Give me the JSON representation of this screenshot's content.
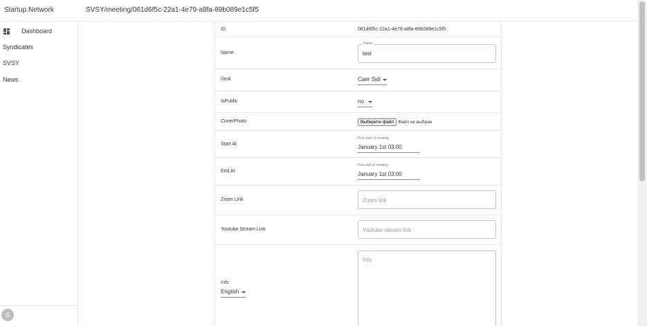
{
  "app": {
    "brand": "Startup.Network"
  },
  "breadcrumb": "SVSY/meeting/061d6f5c-22a1-4e79-a8fa-89b089e1c5f5",
  "sidebar": {
    "items": [
      {
        "label": "Dashboard",
        "icon": "dashboard-icon"
      },
      {
        "label": "Syndicates"
      },
      {
        "label": "SVSY"
      },
      {
        "label": "News"
      }
    ],
    "avatar_initial": "S"
  },
  "form": {
    "id": {
      "label": "ID",
      "value": "061d6f5c-22a1-4e79-a8fa-89b089e1c5f5"
    },
    "name": {
      "label": "Name",
      "legend": "Name",
      "value": "test"
    },
    "deal": {
      "label": "Deal",
      "value": "Caer Sidi"
    },
    "is_public": {
      "label": "IsPublic",
      "value": "no"
    },
    "cover_photo": {
      "label": "CoverPhoto",
      "button": "Выберите файл",
      "status": "Файл не выбран"
    },
    "start_at": {
      "label": "Start At",
      "hint": "Pick start of meeting",
      "value": "January 1st 03:00"
    },
    "end_at": {
      "label": "End At",
      "hint": "Pick end of meeting",
      "value": "January 1st 03:00"
    },
    "zoom_link": {
      "label": "Zoom Link",
      "placeholder": "Zoom link"
    },
    "youtube_link": {
      "label": "Youtube Stream Link",
      "placeholder": "Youtube stream link"
    },
    "info": {
      "label": "Info",
      "language": "English",
      "placeholder": "Info"
    }
  }
}
